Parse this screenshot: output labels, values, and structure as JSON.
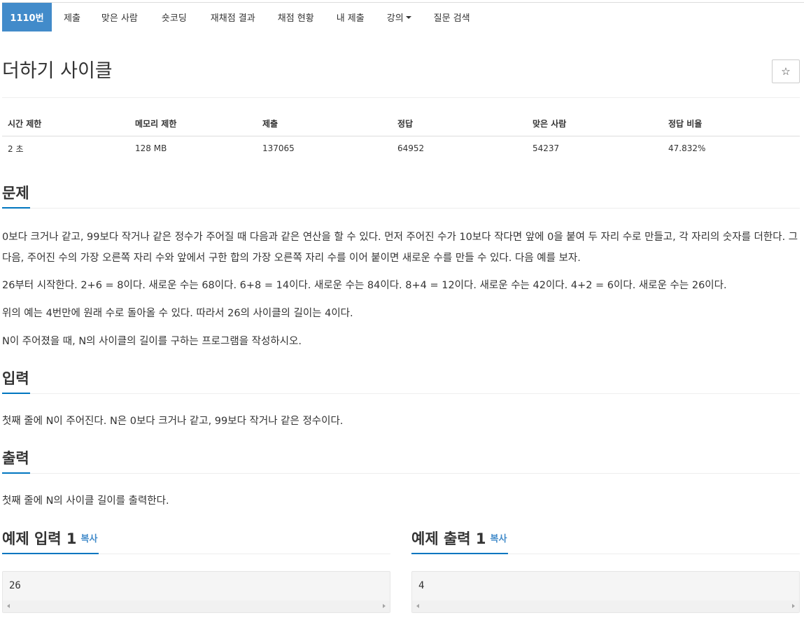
{
  "tabs": [
    {
      "label": "1110번"
    },
    {
      "label": "제출"
    },
    {
      "label": "맞은 사람"
    },
    {
      "label": "숏코딩"
    },
    {
      "label": "재채점 결과"
    },
    {
      "label": "채점 현황"
    },
    {
      "label": "내 제출"
    },
    {
      "label": "강의"
    },
    {
      "label": "질문 검색"
    }
  ],
  "problem": {
    "title": "더하기 사이클",
    "star_icon": "☆"
  },
  "info": {
    "headers": [
      "시간 제한",
      "메모리 제한",
      "제출",
      "정답",
      "맞은 사람",
      "정답 비율"
    ],
    "values": [
      "2 초",
      "128 MB",
      "137065",
      "64952",
      "54237",
      "47.832%"
    ]
  },
  "sections": {
    "problem": {
      "heading": "문제",
      "paragraphs": [
        "0보다 크거나 같고, 99보다 작거나 같은 정수가 주어질 때 다음과 같은 연산을 할 수 있다. 먼저 주어진 수가 10보다 작다면 앞에 0을 붙여 두 자리 수로 만들고, 각 자리의 숫자를 더한다. 그 다음, 주어진 수의 가장 오른쪽 자리 수와 앞에서 구한 합의 가장 오른쪽 자리 수를 이어 붙이면 새로운 수를 만들 수 있다. 다음 예를 보자.",
        "26부터 시작한다. 2+6 = 8이다. 새로운 수는 68이다. 6+8 = 14이다. 새로운 수는 84이다. 8+4 = 12이다. 새로운 수는 42이다. 4+2 = 6이다. 새로운 수는 26이다.",
        "위의 예는 4번만에 원래 수로 돌아올 수 있다. 따라서 26의 사이클의 길이는 4이다.",
        "N이 주어졌을 때, N의 사이클의 길이를 구하는 프로그램을 작성하시오."
      ]
    },
    "input": {
      "heading": "입력",
      "text": "첫째 줄에 N이 주어진다. N은 0보다 크거나 같고, 99보다 작거나 같은 정수이다."
    },
    "output": {
      "heading": "출력",
      "text": "첫째 줄에 N의 사이클 길이를 출력한다."
    }
  },
  "samples": {
    "input": {
      "heading": "예제 입력 1",
      "copy_label": "복사",
      "value": "26"
    },
    "output": {
      "heading": "예제 출력 1",
      "copy_label": "복사",
      "value": "4"
    }
  },
  "colors": {
    "active_tab": "#428bca",
    "section_underline": "#0076c0",
    "link": "#428bca"
  }
}
